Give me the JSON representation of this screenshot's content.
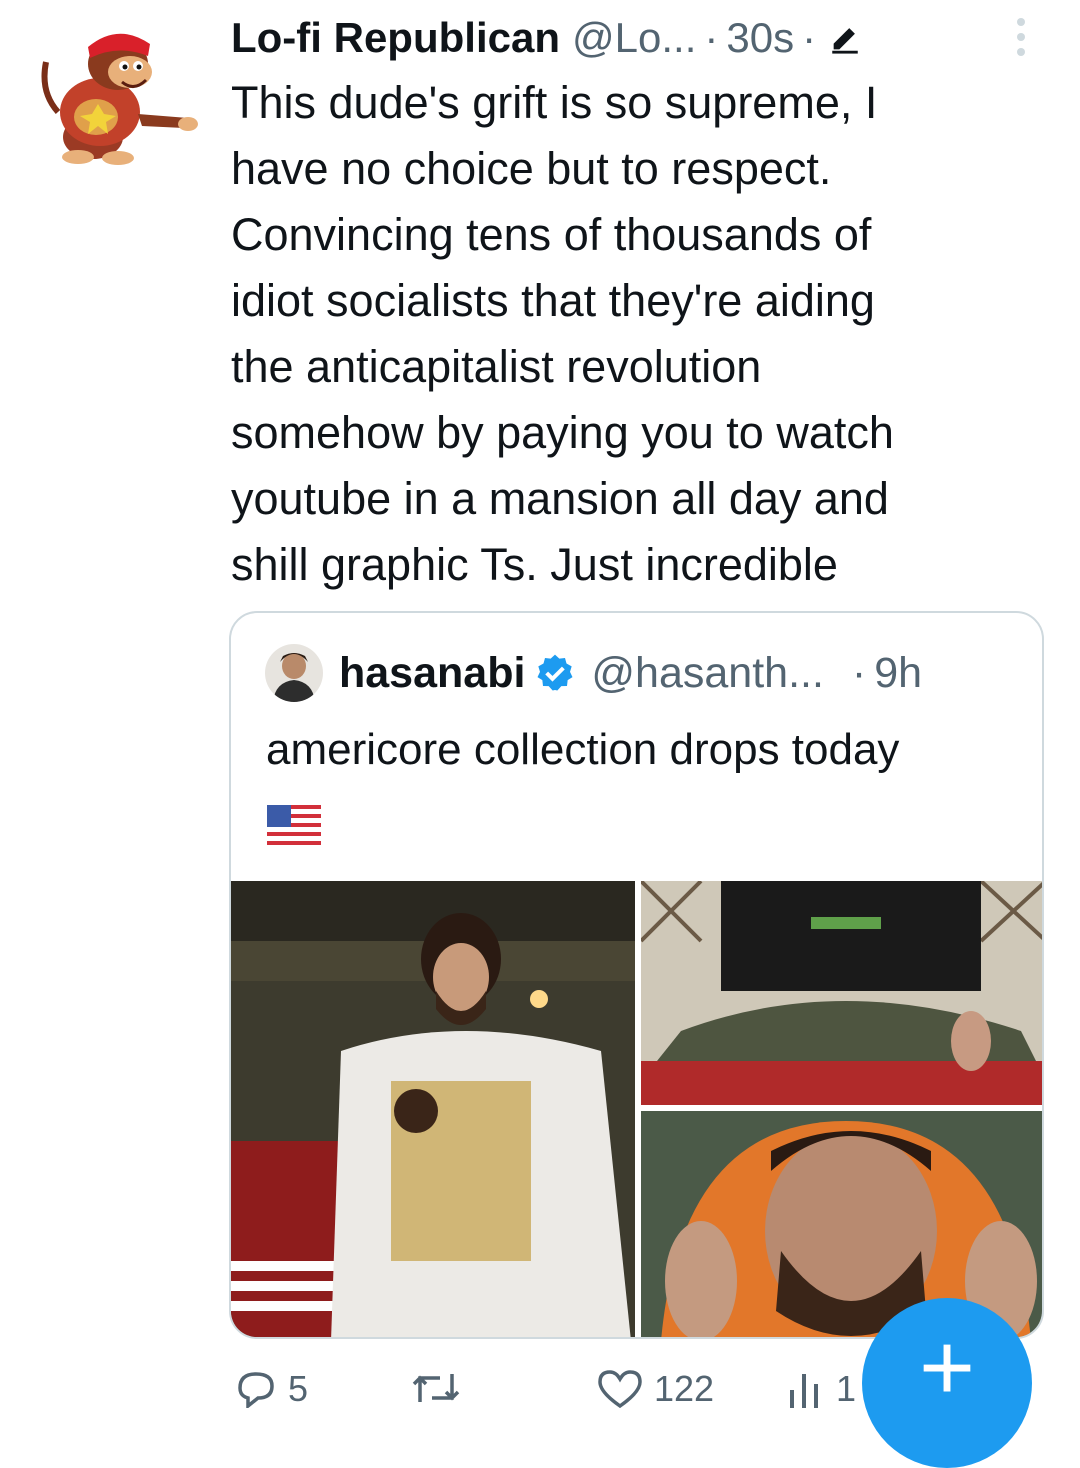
{
  "tweet": {
    "author_name": "Lo-fi Republican",
    "author_handle": "@Lo...",
    "separator": "·",
    "time": "30s",
    "avatar_icon": "monkey-avatar",
    "edit_icon": "pencil-icon",
    "more_icon": "more-vertical-icon",
    "text_lines": [
      "This dude's grift is so supreme, I",
      "have no choice but to respect.",
      "Convincing tens of thousands of",
      "idiot socialists that they're aiding",
      "the anticapitalist revolution",
      "somehow by paying you to watch",
      "youtube in a mansion all day and",
      "shill graphic Ts. Just incredible"
    ]
  },
  "quoted_tweet": {
    "author_name": "hasanabi",
    "author_handle": "@hasanth...",
    "separator": "·",
    "time": "9h",
    "verified_icon": "verified-badge-icon",
    "text": "americore collection drops today",
    "flag_emoji": "us-flag-icon",
    "media_count": 3
  },
  "actions": {
    "reply_count": "5",
    "retweet_count": "",
    "like_count": "122",
    "views_count": "1"
  },
  "compose_button": {
    "label": "+"
  },
  "colors": {
    "text_primary": "#0f1419",
    "text_secondary": "#536471",
    "accent": "#1d9bf0",
    "border": "#cfd9de"
  }
}
